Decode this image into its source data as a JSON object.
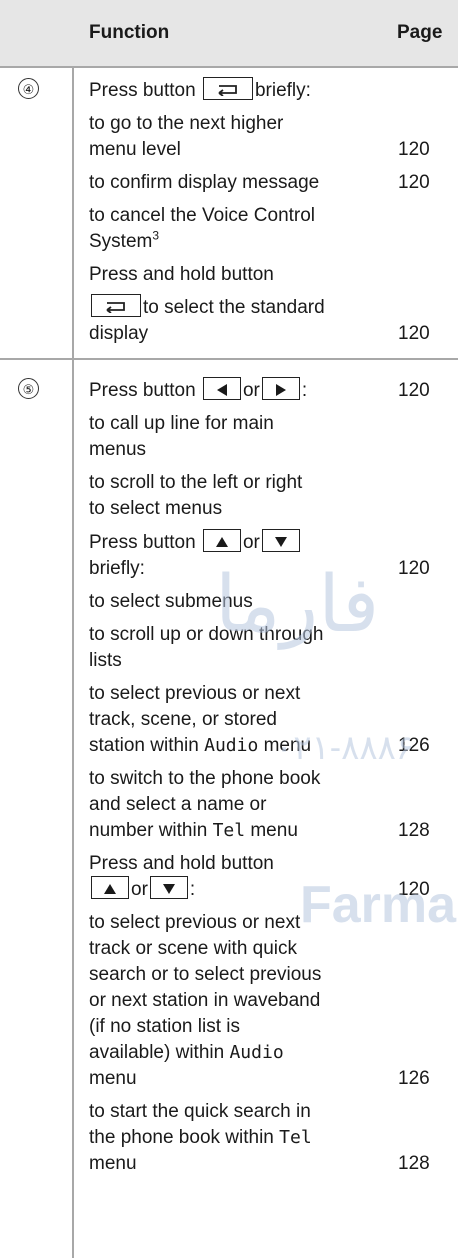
{
  "header": {
    "function_label": "Function",
    "page_label": "Page"
  },
  "rows": [
    {
      "number": "④",
      "lines": [
        {
          "pre": "Press button",
          "key": "back",
          "post": "briefly:"
        },
        {
          "text": "to go to the next higher"
        },
        {
          "text": "menu level",
          "page": "120"
        },
        {
          "text": "to confirm display message",
          "page": "120"
        },
        {
          "text": "to cancel the Voice Control"
        },
        {
          "text": "System",
          "sup": "3"
        },
        {
          "text": "Press and hold button"
        },
        {
          "key": "back",
          "post": "to select the standard"
        },
        {
          "text": "display",
          "page": "120"
        }
      ]
    },
    {
      "number": "⑤",
      "lines": [
        {
          "pre": "Press button",
          "key": "left",
          "mid": "or",
          "key2": "right",
          "post": ":",
          "page": "120"
        },
        {
          "text": "to call up line for main"
        },
        {
          "text": "menus"
        },
        {
          "text": "to scroll to the left or right"
        },
        {
          "text": "to select menus"
        },
        {
          "pre": "Press button",
          "key": "up",
          "mid": "or",
          "key2": "down"
        },
        {
          "text": "briefly:",
          "page": "120"
        },
        {
          "text": "to select submenus"
        },
        {
          "text": "to scroll up or down through"
        },
        {
          "text": "lists"
        },
        {
          "text": "to select previous or next"
        },
        {
          "text": "track, scene, or stored"
        },
        {
          "text": "station within",
          "mono": "Audio",
          "post": "menu",
          "page": "126"
        },
        {
          "text": "to switch to the phone book"
        },
        {
          "text": "and select a name or"
        },
        {
          "text": "number within",
          "mono": "Tel",
          "post": "menu",
          "page": "128"
        },
        {
          "text": "Press and hold button"
        },
        {
          "key": "up",
          "mid": "or",
          "key2": "down",
          "post": ":",
          "page": "120"
        },
        {
          "text": "to select previous or next"
        },
        {
          "text": "track or scene with quick"
        },
        {
          "text": "search or to select previous"
        },
        {
          "text": "or next station in waveband"
        },
        {
          "text": "(if no station list is"
        },
        {
          "text": "available) within",
          "mono": "Audio"
        },
        {
          "text": "menu",
          "page": "126"
        },
        {
          "text": "to start the quick search in"
        },
        {
          "text": "the phone book within",
          "mono": "Tel"
        },
        {
          "text": "menu",
          "page": "128"
        }
      ]
    }
  ],
  "watermark": {
    "top": "فارما",
    "middle": "۰۲۱-۸۸۸۶",
    "bottom": "Farma"
  },
  "icons": {
    "back": "back-arrow-icon",
    "left": "arrow-left-icon",
    "right": "arrow-right-icon",
    "up": "arrow-up-icon",
    "down": "arrow-down-icon"
  }
}
